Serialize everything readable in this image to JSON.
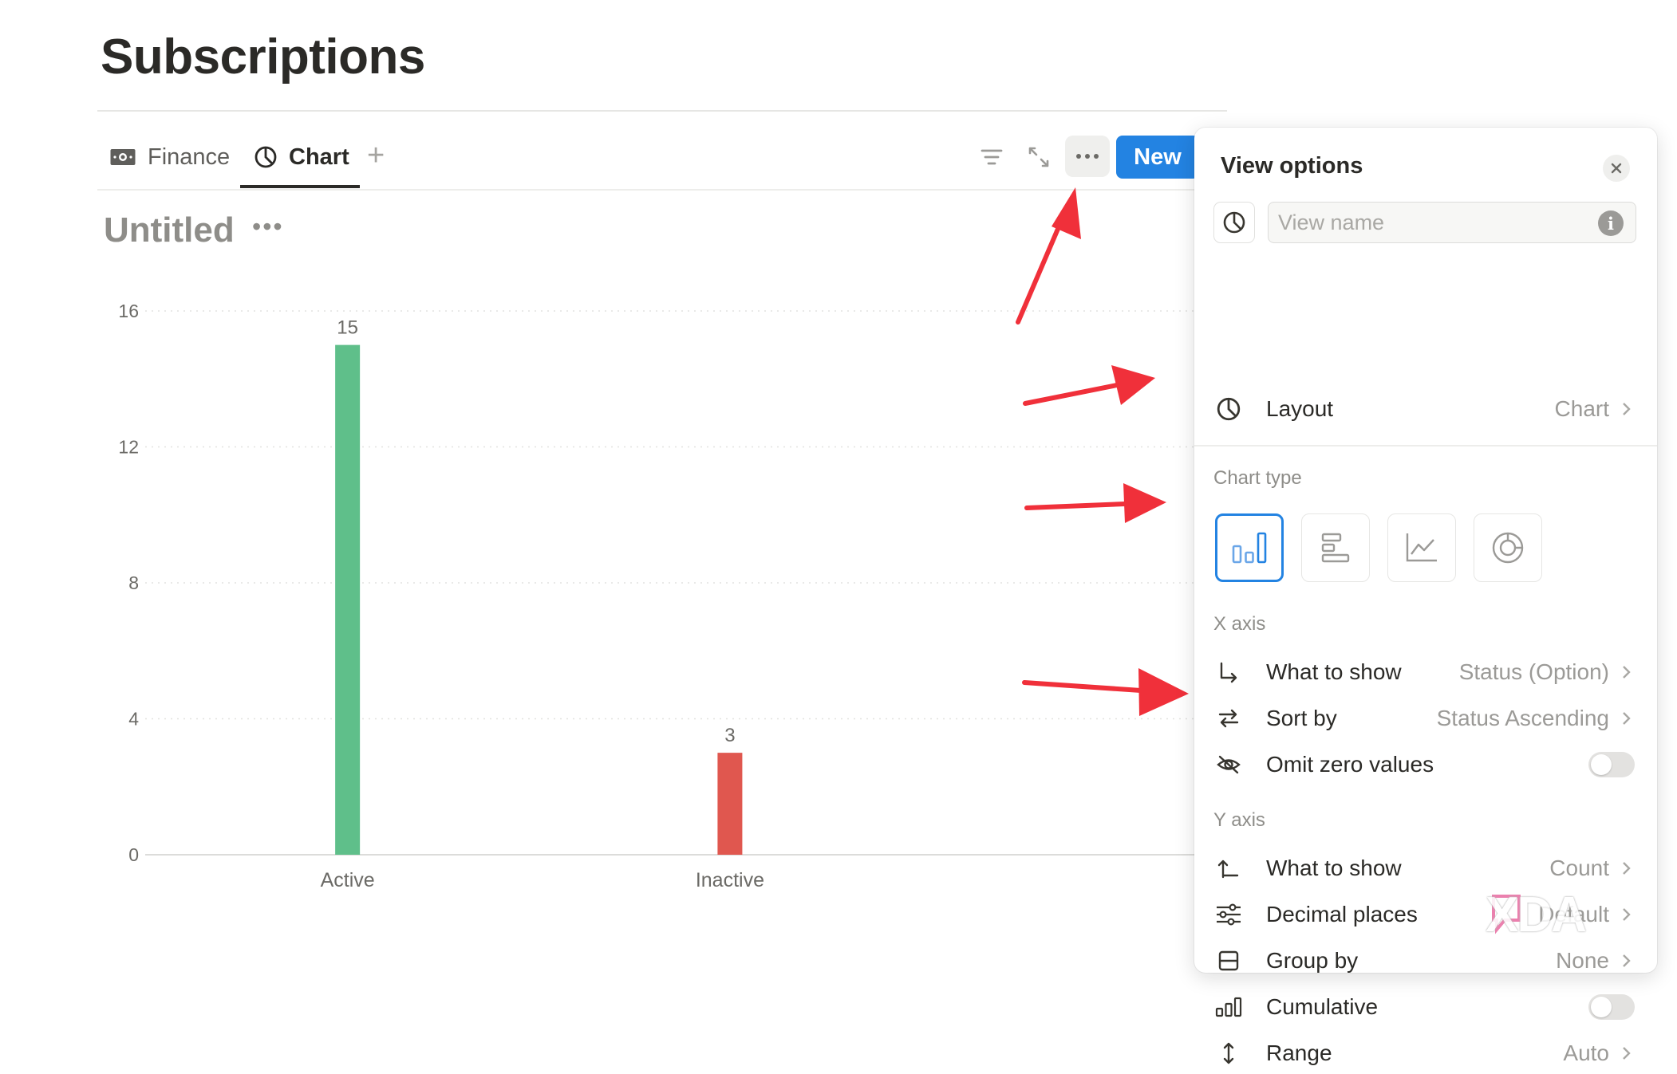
{
  "page": {
    "title": "Subscriptions"
  },
  "tabs": [
    {
      "label": "Finance",
      "icon": "money-icon"
    },
    {
      "label": "Chart",
      "icon": "chart-icon",
      "active": true
    }
  ],
  "toolbar": {
    "new_label": "New"
  },
  "view": {
    "title": "Untitled"
  },
  "chart_data": {
    "type": "bar",
    "categories": [
      "Active",
      "Inactive"
    ],
    "values": [
      15,
      3
    ],
    "data_labels": [
      "15",
      "3"
    ],
    "colors": [
      "#5fbf8a",
      "#e0574f"
    ],
    "yticks": [
      "0",
      "4",
      "8",
      "12",
      "16"
    ],
    "ylim": [
      0,
      16
    ],
    "grid": true,
    "title": "",
    "xlabel": "",
    "ylabel": ""
  },
  "panel": {
    "title": "View options",
    "view_name_placeholder": "View name",
    "layout": {
      "label": "Layout",
      "value": "Chart"
    },
    "chart_type_label": "Chart type",
    "chart_types": [
      "vertical-bar",
      "horizontal-bar",
      "line",
      "donut"
    ],
    "selected_chart_type": "vertical-bar",
    "x_axis": {
      "section": "X axis",
      "what_to_show": {
        "label": "What to show",
        "value": "Status (Option)"
      },
      "sort_by": {
        "label": "Sort by",
        "value": "Status Ascending"
      },
      "omit_zero": {
        "label": "Omit zero values",
        "on": false
      }
    },
    "y_axis": {
      "section": "Y axis",
      "what_to_show": {
        "label": "What to show",
        "value": "Count"
      },
      "decimal_places": {
        "label": "Decimal places",
        "value": "Default"
      },
      "group_by": {
        "label": "Group by",
        "value": "None"
      },
      "cumulative": {
        "label": "Cumulative",
        "on": false
      },
      "range": {
        "label": "Range",
        "value": "Auto"
      }
    }
  },
  "watermark": {
    "text": "XDA"
  },
  "colors": {
    "accent": "#2383e2",
    "annotation": "#f0303a"
  }
}
